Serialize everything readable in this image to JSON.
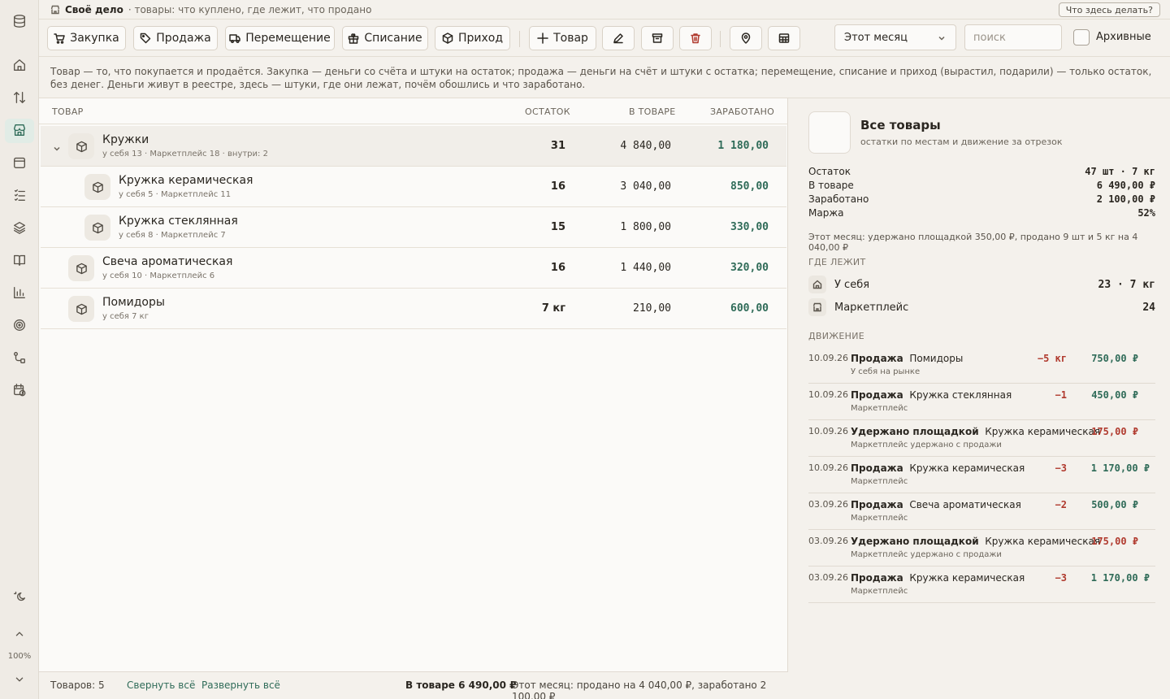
{
  "app": {
    "name": "Своё дело",
    "subtitle": "· товары: что куплено, где лежит, что продано",
    "help": "Что здесь делать?"
  },
  "rail": {
    "zoom": "100%"
  },
  "toolbar": {
    "buy": "Закупка",
    "sell": "Продажа",
    "move": "Перемещение",
    "writeoff": "Списание",
    "income": "Приход",
    "add_item": "Товар",
    "period": "Этот месяц",
    "search_placeholder": "поиск",
    "archived": "Архивные"
  },
  "description": "Товар — то, что покупается и продаётся. Закупка — деньги со счёта и штуки на остаток; продажа — деньги на счёт и штуки с остатка; перемещение, списание и приход (вырастил, подарили) — только остаток, без денег. Деньги живут в реестре, здесь — штуки, где они лежат, почём обошлись и что заработано.",
  "table": {
    "headers": {
      "item": "ТОВАР",
      "stock": "ОСТАТОК",
      "value": "В ТОВАРЕ",
      "earned": "ЗАРАБОТАНО"
    },
    "rows": [
      {
        "name": "Кружки",
        "meta": "у себя 13 · Маркетплейс 18 · внутри: 2",
        "stock": "31",
        "value": "4 840,00",
        "earned": "1 180,00"
      },
      {
        "name": "Кружка керамическая",
        "meta": "у себя 5 · Маркетплейс 11",
        "stock": "16",
        "value": "3 040,00",
        "earned": "850,00"
      },
      {
        "name": "Кружка стеклянная",
        "meta": "у себя 8 · Маркетплейс 7",
        "stock": "15",
        "value": "1 800,00",
        "earned": "330,00"
      },
      {
        "name": "Свеча ароматическая",
        "meta": "у себя 10 · Маркетплейс 6",
        "stock": "16",
        "value": "1 440,00",
        "earned": "320,00"
      },
      {
        "name": "Помидоры",
        "meta": "у себя 7 кг",
        "stock": "7 кг",
        "value": "210,00",
        "earned": "600,00"
      }
    ]
  },
  "footer": {
    "count": "Товаров: 5",
    "collapse": "Свернуть всё",
    "expand": "Развернуть всё",
    "total": "В товаре 6 490,00 ₽",
    "month": "Этот месяц: продано на 4 040,00 ₽, заработано 2 100,00 ₽"
  },
  "side": {
    "title": "Все товары",
    "subtitle": "остатки по местам и движение за отрезок",
    "stats": [
      {
        "k": "Остаток",
        "v": "47 шт · 7 кг"
      },
      {
        "k": "В товаре",
        "v": "6 490,00 ₽"
      },
      {
        "k": "Заработано",
        "v": "2 100,00 ₽"
      },
      {
        "k": "Маржа",
        "v": "52%"
      }
    ],
    "note": "Этот месяц: удержано площадкой 350,00 ₽, продано 9 шт и 5 кг на 4 040,00 ₽",
    "where_title": "ГДЕ ЛЕЖИТ",
    "locations": [
      {
        "name": "У себя",
        "value": "23 · 7 кг",
        "icon": "home-icon"
      },
      {
        "name": "Маркетплейс",
        "value": "24",
        "icon": "store-icon"
      }
    ],
    "moves_title": "ДВИЖЕНИЕ",
    "moves": [
      {
        "date": "10.09.26",
        "type": "Продажа",
        "item": "Помидоры",
        "sub": "У себя  на рынке",
        "qty": "−5 кг",
        "amount": "750,00 ₽"
      },
      {
        "date": "10.09.26",
        "type": "Продажа",
        "item": "Кружка стеклянная",
        "sub": "Маркетплейс",
        "qty": "−1",
        "amount": "450,00 ₽"
      },
      {
        "date": "10.09.26",
        "type": "Удержано площадкой",
        "item": "Кружка керамическая",
        "sub": "Маркетплейс  удержано с продажи",
        "qty": "",
        "amount": "175,00 ₽"
      },
      {
        "date": "10.09.26",
        "type": "Продажа",
        "item": "Кружка керамическая",
        "sub": "Маркетплейс",
        "qty": "−3",
        "amount": "1 170,00 ₽"
      },
      {
        "date": "03.09.26",
        "type": "Продажа",
        "item": "Свеча ароматическая",
        "sub": "Маркетплейс",
        "qty": "−2",
        "amount": "500,00 ₽"
      },
      {
        "date": "03.09.26",
        "type": "Удержано площадкой",
        "item": "Кружка керамическая",
        "sub": "Маркетплейс  удержано с продажи",
        "qty": "",
        "amount": "175,00 ₽"
      },
      {
        "date": "03.09.26",
        "type": "Продажа",
        "item": "Кружка керамическая",
        "sub": "Маркетплейс",
        "qty": "−3",
        "amount": "1 170,00 ₽"
      }
    ]
  }
}
